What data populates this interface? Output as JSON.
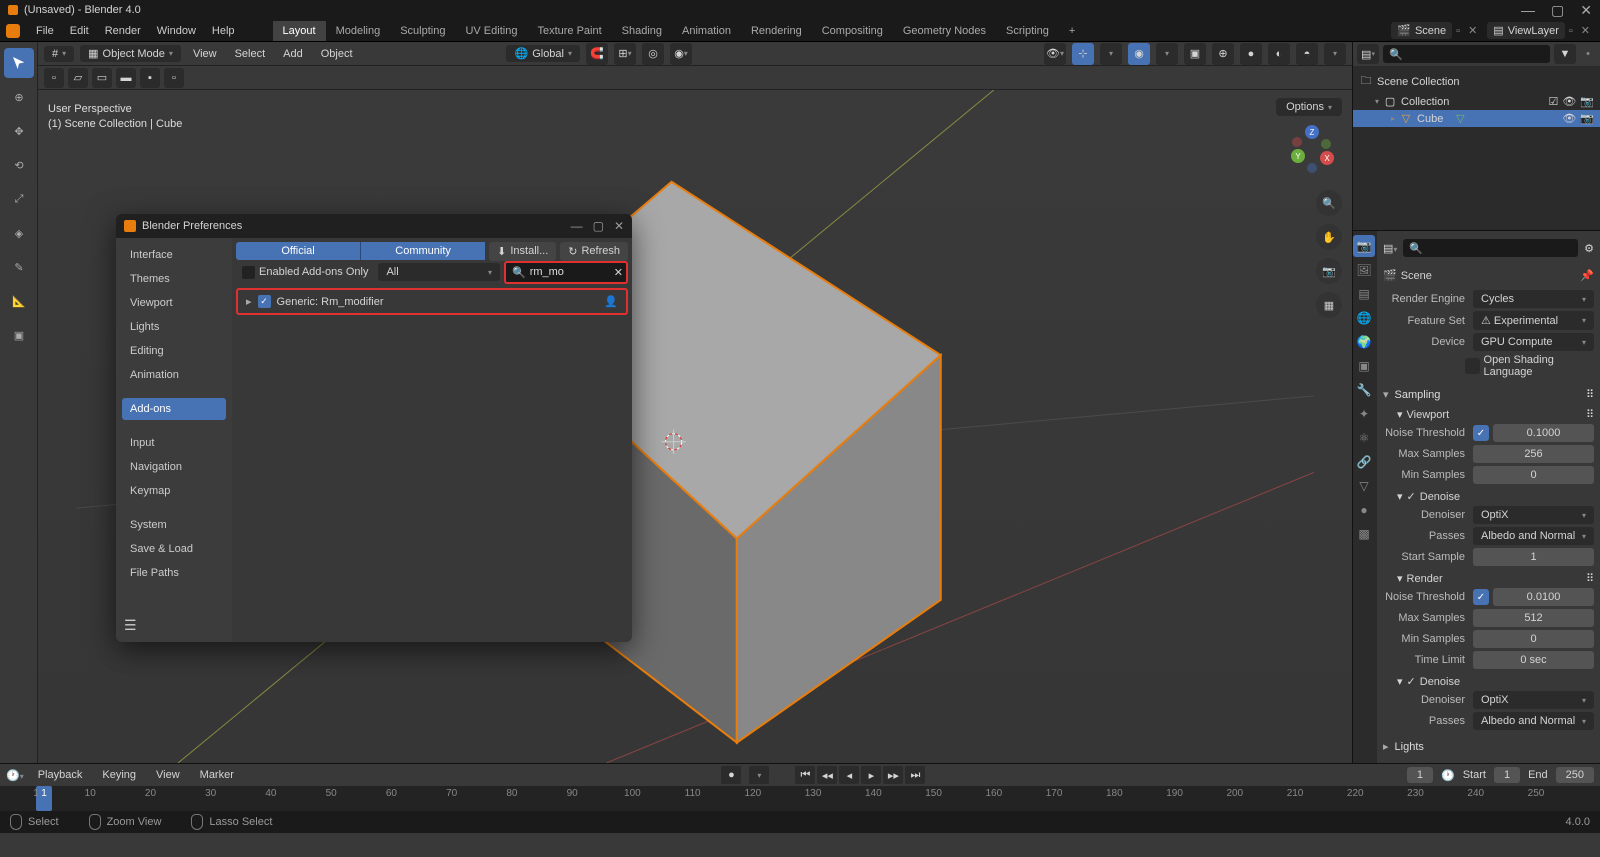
{
  "titlebar": {
    "title": "(Unsaved) - Blender 4.0"
  },
  "menu": {
    "file": "File",
    "edit": "Edit",
    "render": "Render",
    "window": "Window",
    "help": "Help"
  },
  "workspaces": [
    "Layout",
    "Modeling",
    "Sculpting",
    "UV Editing",
    "Texture Paint",
    "Shading",
    "Animation",
    "Rendering",
    "Compositing",
    "Geometry Nodes",
    "Scripting"
  ],
  "scene_slot": {
    "label": "Scene"
  },
  "layer_slot": {
    "label": "ViewLayer"
  },
  "vp_header": {
    "mode": "Object Mode",
    "menus": [
      "View",
      "Select",
      "Add",
      "Object"
    ],
    "orientation": "Global"
  },
  "vp_info": {
    "line1": "User Perspective",
    "line2": "(1) Scene Collection | Cube"
  },
  "options_label": "Options",
  "prefs": {
    "title": "Blender Preferences",
    "nav": [
      "Interface",
      "Themes",
      "Viewport",
      "Lights",
      "Editing",
      "Animation"
    ],
    "nav2": [
      "Add-ons"
    ],
    "nav3": [
      "Input",
      "Navigation",
      "Keymap"
    ],
    "nav4": [
      "System",
      "Save & Load",
      "File Paths"
    ],
    "tab_official": "Official",
    "tab_community": "Community",
    "install": "Install...",
    "refresh": "Refresh",
    "enabled_only": "Enabled Add-ons Only",
    "category": "All",
    "search_value": "rm_mo",
    "addon_name": "Generic: Rm_modifier"
  },
  "outliner": {
    "root": "Scene Collection",
    "collection": "Collection",
    "cube": "Cube"
  },
  "props": {
    "scene": "Scene",
    "render_engine_lbl": "Render Engine",
    "render_engine": "Cycles",
    "feature_set_lbl": "Feature Set",
    "feature_set": "Experimental",
    "device_lbl": "Device",
    "device": "GPU Compute",
    "osl": "Open Shading Language",
    "sampling": "Sampling",
    "viewport": "Viewport",
    "noise_thr_lbl": "Noise Threshold",
    "vp_noise": "0.1000",
    "max_samples_lbl": "Max Samples",
    "vp_max": "256",
    "min_samples_lbl": "Min Samples",
    "vp_min": "0",
    "denoise": "Denoise",
    "denoiser_lbl": "Denoiser",
    "denoiser": "OptiX",
    "passes_lbl": "Passes",
    "passes": "Albedo and Normal",
    "start_sample_lbl": "Start Sample",
    "start_sample": "1",
    "render": "Render",
    "r_noise": "0.0100",
    "r_max": "512",
    "r_min": "0",
    "time_limit_lbl": "Time Limit",
    "time_limit": "0 sec",
    "lights": "Lights"
  },
  "timeline": {
    "menus": [
      "Playback",
      "Keying",
      "View",
      "Marker"
    ],
    "frame": "1",
    "start_lbl": "Start",
    "start": "1",
    "end_lbl": "End",
    "end": "250",
    "ticks": [
      1,
      10,
      20,
      30,
      40,
      50,
      60,
      70,
      80,
      90,
      100,
      110,
      120,
      130,
      140,
      150,
      160,
      170,
      180,
      190,
      200,
      210,
      220,
      230,
      240,
      250
    ]
  },
  "status": {
    "select": "Select",
    "zoom": "Zoom View",
    "lasso": "Lasso Select",
    "version": "4.0.0"
  }
}
